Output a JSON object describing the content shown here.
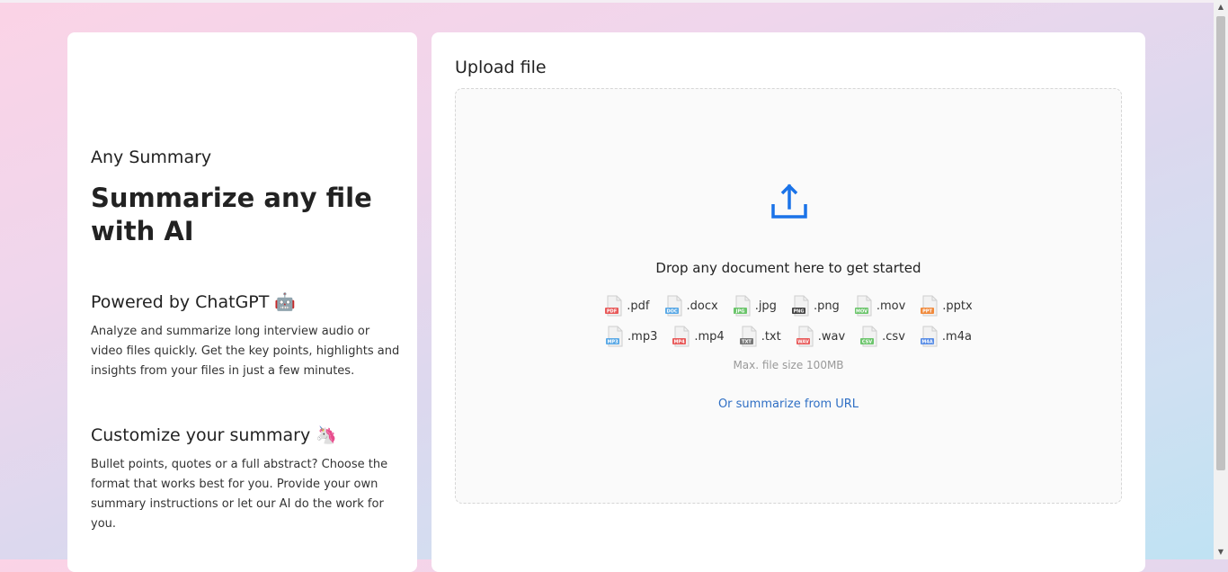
{
  "left": {
    "brand": "Any Summary",
    "hero_title": "Summarize any file with AI",
    "section1": {
      "title": "Powered by ChatGPT 🤖",
      "text": "Analyze and summarize long interview audio or video files quickly. Get the key points, highlights and insights from your files in just a few minutes."
    },
    "section2": {
      "title": "Customize your summary 🦄",
      "text": "Bullet points, quotes or a full abstract? Choose the format that works best for you. Provide your own summary instructions or let our AI do the work for you."
    }
  },
  "upload": {
    "title": "Upload file",
    "icon": "upload-icon",
    "accent_color": "#1a73e8",
    "drop_text": "Drop any document here to get started",
    "file_types_row1": [
      {
        "label": ".pdf",
        "color": "#e85a5a",
        "tag": "PDF"
      },
      {
        "label": ".docx",
        "color": "#5aa9e6",
        "tag": "DOC"
      },
      {
        "label": ".jpg",
        "color": "#6cc56c",
        "tag": "JPG"
      },
      {
        "label": ".png",
        "color": "#444444",
        "tag": "PNG"
      },
      {
        "label": ".mov",
        "color": "#6cc56c",
        "tag": "MOV"
      },
      {
        "label": ".pptx",
        "color": "#f08a3c",
        "tag": "PPT"
      }
    ],
    "file_types_row2": [
      {
        "label": ".mp3",
        "color": "#5aa9e6",
        "tag": "MP3"
      },
      {
        "label": ".mp4",
        "color": "#e85a5a",
        "tag": "MP4"
      },
      {
        "label": ".txt",
        "color": "#777777",
        "tag": "TXT"
      },
      {
        "label": ".wav",
        "color": "#e85a5a",
        "tag": "WAV"
      },
      {
        "label": ".csv",
        "color": "#6cc56c",
        "tag": "CSV"
      },
      {
        "label": ".m4a",
        "color": "#5a8ee6",
        "tag": "M4A"
      }
    ],
    "max_size": "Max. file size 100MB",
    "url_link": "Or summarize from URL"
  }
}
